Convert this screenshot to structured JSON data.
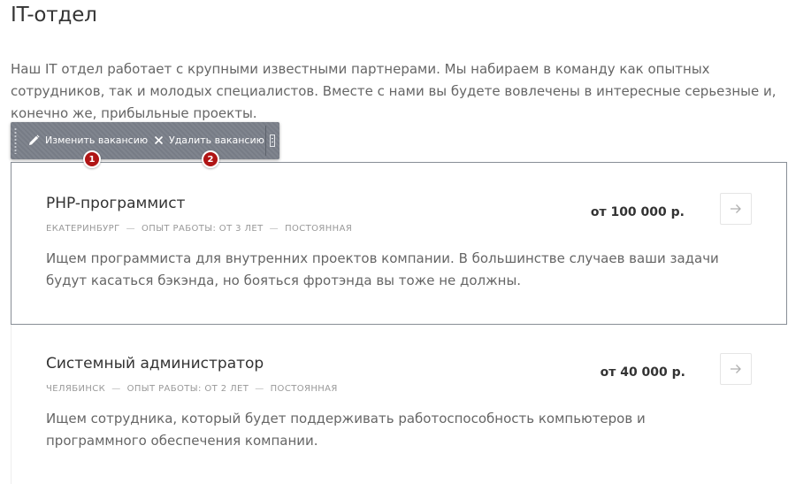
{
  "page": {
    "title": "IT-отдел",
    "intro": "Наш IT отдел работает с крупными известными партнерами. Мы набираем в команду как опытных сотрудников, так и молодых специалистов. Вместе с нами вы будете вовлечены в интересные серьезные и, конечно же, прибыльные проекты."
  },
  "toolbar": {
    "edit_label": "Изменить вакансию",
    "delete_label": "Удалить вакансию",
    "edit_icon": "pencil-icon",
    "delete_icon": "close-icon",
    "badge_1": "1",
    "badge_2": "2",
    "badge_color": "#b01515",
    "bg_color": "#7b808a"
  },
  "vacancies": [
    {
      "title": "PHP-программист",
      "city": "Екатеринбург",
      "experience": "Опыт работы:  от 3 лет",
      "type": "Постоянная",
      "salary": "от 100 000 р.",
      "description": "Ищем программиста для внутренних проектов компании. В большинстве случаев ваши задачи будут касаться бэкэнда, но бояться фротэнда вы тоже не должны.",
      "arrow_icon": "arrow-right-icon"
    },
    {
      "title": "Системный администратор",
      "city": "Челябинск",
      "experience": "Опыт работы:  от 2 лет",
      "type": "Постоянная",
      "salary": "от 40 000 р.",
      "description": "Ищем сотрудника, который будет поддерживать работоспособность компьютеров и программного обеспечения компании.",
      "arrow_icon": "arrow-right-icon"
    }
  ],
  "meta_separator": "—"
}
